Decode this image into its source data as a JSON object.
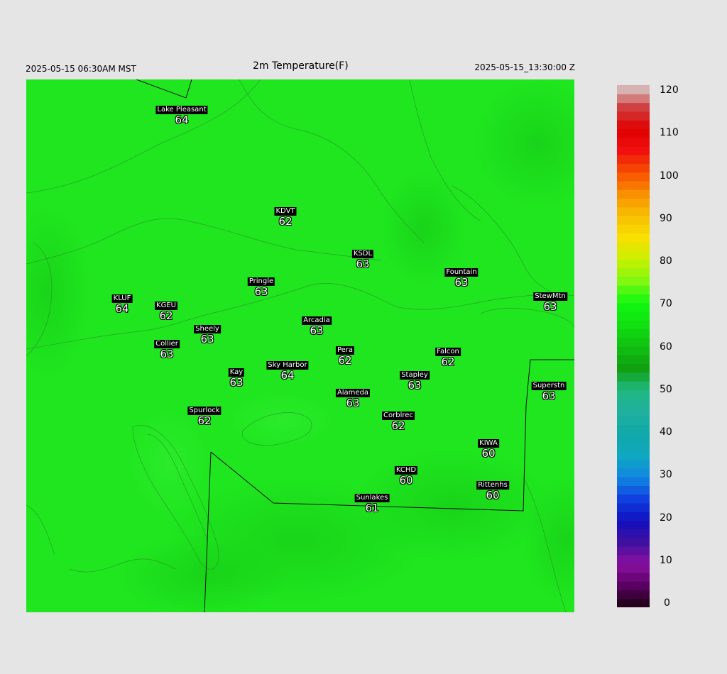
{
  "header": {
    "local_time": "2025-05-15 06:30AM MST",
    "title": "2m Temperature(F)",
    "utc_time": "2025-05-15_13:30:00 Z"
  },
  "stations": [
    {
      "name": "Lake Pleasant",
      "value": "64"
    },
    {
      "name": "KDVT",
      "value": "62"
    },
    {
      "name": "KSDL",
      "value": "63"
    },
    {
      "name": "Fountain",
      "value": "63"
    },
    {
      "name": "Pringle",
      "value": "63"
    },
    {
      "name": "KLUF",
      "value": "64"
    },
    {
      "name": "KGEU",
      "value": "62"
    },
    {
      "name": "StewMtn",
      "value": "63"
    },
    {
      "name": "Arcadia",
      "value": "63"
    },
    {
      "name": "Sheely",
      "value": "63"
    },
    {
      "name": "Collier",
      "value": "63"
    },
    {
      "name": "Pera",
      "value": "62"
    },
    {
      "name": "Falcon",
      "value": "62"
    },
    {
      "name": "Kay",
      "value": "63"
    },
    {
      "name": "Sky Harbor",
      "value": "64"
    },
    {
      "name": "Stapley",
      "value": "63"
    },
    {
      "name": "Superstn",
      "value": "63"
    },
    {
      "name": "Alameda",
      "value": "63"
    },
    {
      "name": "Spurlock",
      "value": "62"
    },
    {
      "name": "Corblrec",
      "value": "62"
    },
    {
      "name": "KIWA",
      "value": "60"
    },
    {
      "name": "KCHD",
      "value": "60"
    },
    {
      "name": "Rittenhs",
      "value": "60"
    },
    {
      "name": "Sunlakes",
      "value": "61"
    }
  ],
  "colorbar": {
    "min": 0,
    "max": 120,
    "labels": [
      "120",
      "110",
      "100",
      "90",
      "80",
      "70",
      "60",
      "50",
      "40",
      "30",
      "20",
      "10",
      "0"
    ]
  }
}
